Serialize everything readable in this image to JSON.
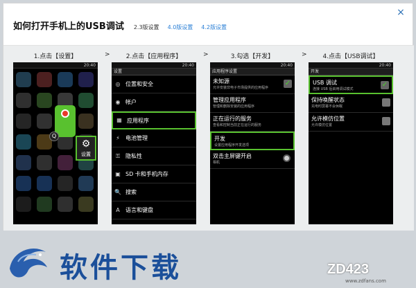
{
  "dialog": {
    "title": "如何打开手机上的USB调试",
    "close_glyph": "×",
    "version_tabs": [
      "2.3版设置",
      "4.0版设置",
      "4.2版设置"
    ]
  },
  "arrow_glyph": ">",
  "steps": [
    {
      "title": "1.点击【设置】"
    },
    {
      "title": "2.点击【应用程序】"
    },
    {
      "title": "3.勾选【开发】"
    },
    {
      "title": "4.点击【USB调试】"
    }
  ],
  "phone_common": {
    "time": "20:40"
  },
  "phone1": {
    "settings_label": "设置",
    "search_glyph": "Q",
    "gear_glyph": "⚙"
  },
  "phone2": {
    "header": "设置",
    "items": [
      "位置和安全",
      "帐户",
      "应用程序",
      "电池管理",
      "隐私性",
      "SD 卡和手机内存",
      "搜索",
      "语言和键盘"
    ],
    "icons": [
      "◎",
      "◉",
      "▦",
      "⚡",
      "⚿",
      "▣",
      "🔍",
      "A"
    ]
  },
  "phone3": {
    "header": "应用程序设置",
    "options": [
      {
        "title": "未知源",
        "sub": "允许安装非电子市场提供的应用程序"
      },
      {
        "title": "管理应用程序",
        "sub": "管理和删除安装的应用程序"
      },
      {
        "title": "正在运行的服务",
        "sub": "查看和控制当前正在运行的服务"
      },
      {
        "title": "开发",
        "sub": "设置应用程序开发选项"
      },
      {
        "title": "双击主屏键开启",
        "sub": "相机"
      }
    ]
  },
  "phone4": {
    "header": "开发",
    "options": [
      {
        "title": "USB 调试",
        "sub": "连接 USB 后启用调试模式"
      },
      {
        "title": "保持唤醒状态",
        "sub": "充电时屏幕不会休眠"
      },
      {
        "title": "允许模仿位置",
        "sub": "允许模仿位置"
      }
    ],
    "check_glyph": "✓"
  },
  "brand": {
    "left_text": "软件下载",
    "right_logo": "ZD423",
    "right_url": "www.zdfans.com"
  },
  "colors": {
    "highlight": "#59c12f",
    "link": "#2a7fd6"
  }
}
